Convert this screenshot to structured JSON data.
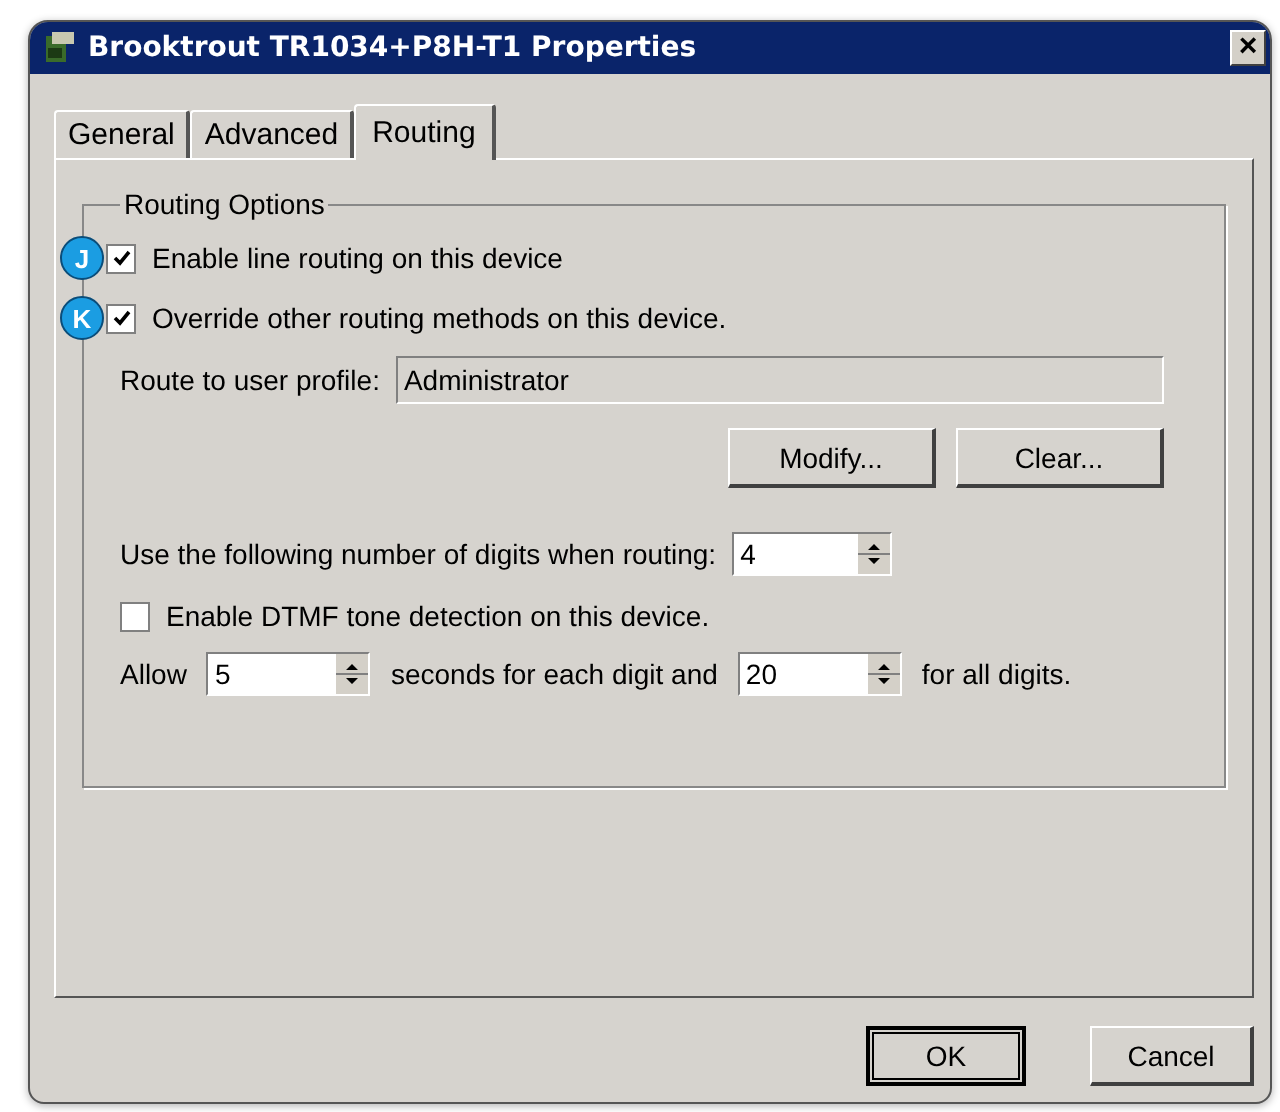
{
  "window": {
    "title": "Brooktrout TR1034+P8H-T1 Properties",
    "close": "×"
  },
  "tabs": [
    {
      "label": "General",
      "selected": false
    },
    {
      "label": "Advanced",
      "selected": false
    },
    {
      "label": "Routing",
      "selected": true
    }
  ],
  "group": {
    "title": "Routing Options"
  },
  "options": [
    {
      "marker": "J",
      "label": "Enable line routing on this device",
      "checked": true
    },
    {
      "marker": "K",
      "label": "Override other routing methods on this device.",
      "checked": true
    }
  ],
  "profile": {
    "label": "Route to user profile:",
    "value": "Administrator"
  },
  "profile_buttons": [
    "Modify...",
    "Clear..."
  ],
  "digits": {
    "label": "Use the following number of digits when routing:",
    "value": "4"
  },
  "dtmf": {
    "label": "Enable DTMF tone detection on this device.",
    "checked": false
  },
  "timing": {
    "before": "Allow",
    "per_digit": "5",
    "middle": "seconds for each digit and",
    "all_digits": "20",
    "after": "for all digits."
  },
  "buttons": [
    {
      "label": "OK",
      "default": true
    },
    {
      "label": "Cancel",
      "default": false
    }
  ]
}
